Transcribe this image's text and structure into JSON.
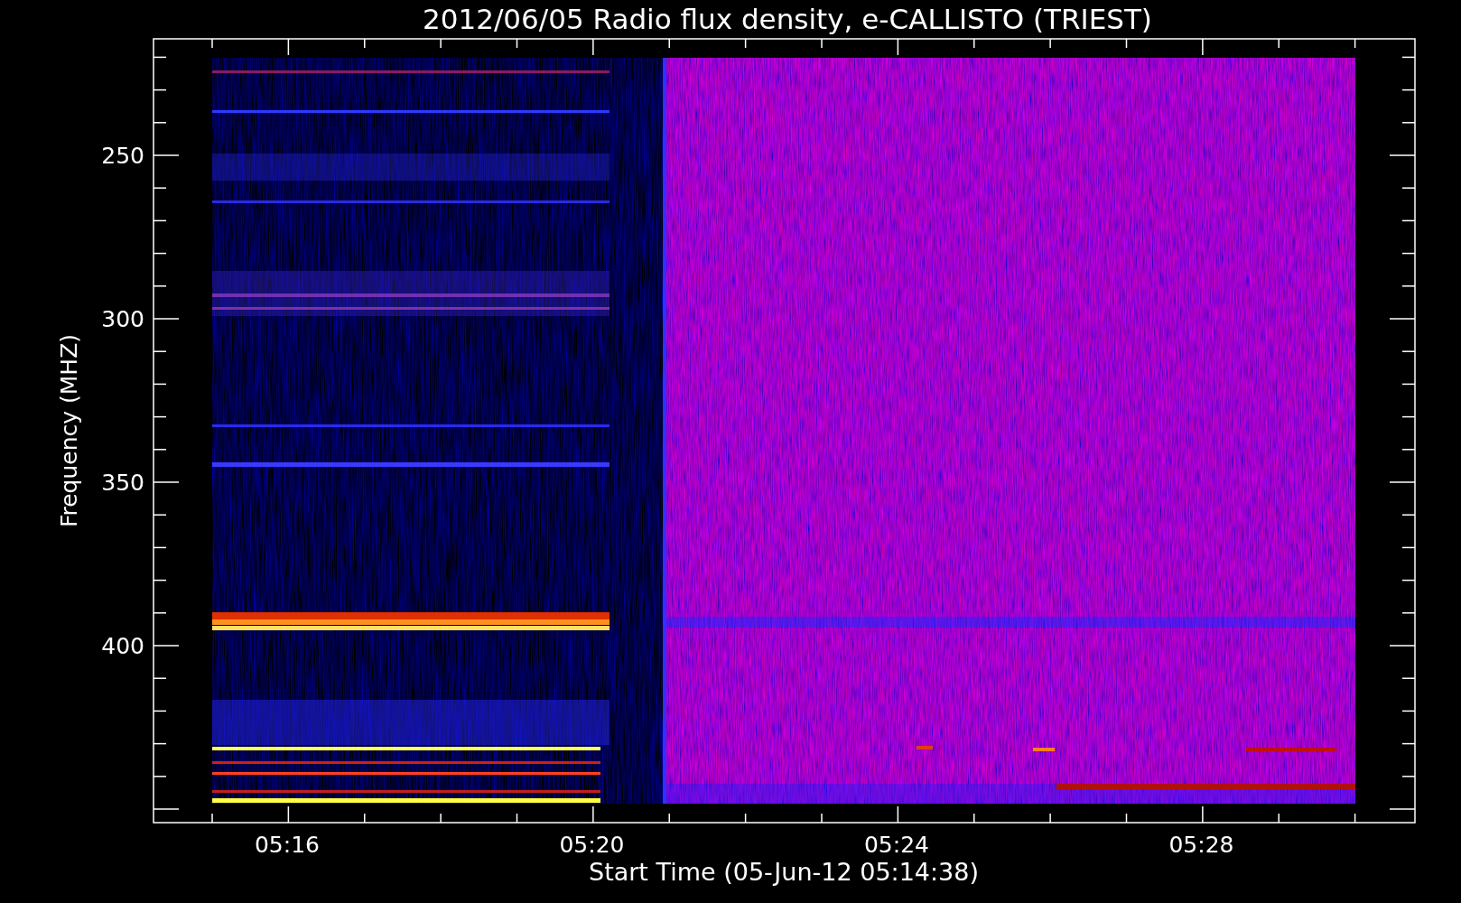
{
  "title": "2012/06/05  Radio flux density, e-CALLISTO (TRIEST)",
  "x_axis": {
    "label": "Start Time (05-Jun-12 05:14:38)",
    "ticks": [
      "05:16",
      "05:20",
      "05:24",
      "05:28"
    ]
  },
  "y_axis": {
    "label": "Frequency (MHZ)",
    "ticks": [
      "250",
      "300",
      "350",
      "400"
    ]
  }
}
